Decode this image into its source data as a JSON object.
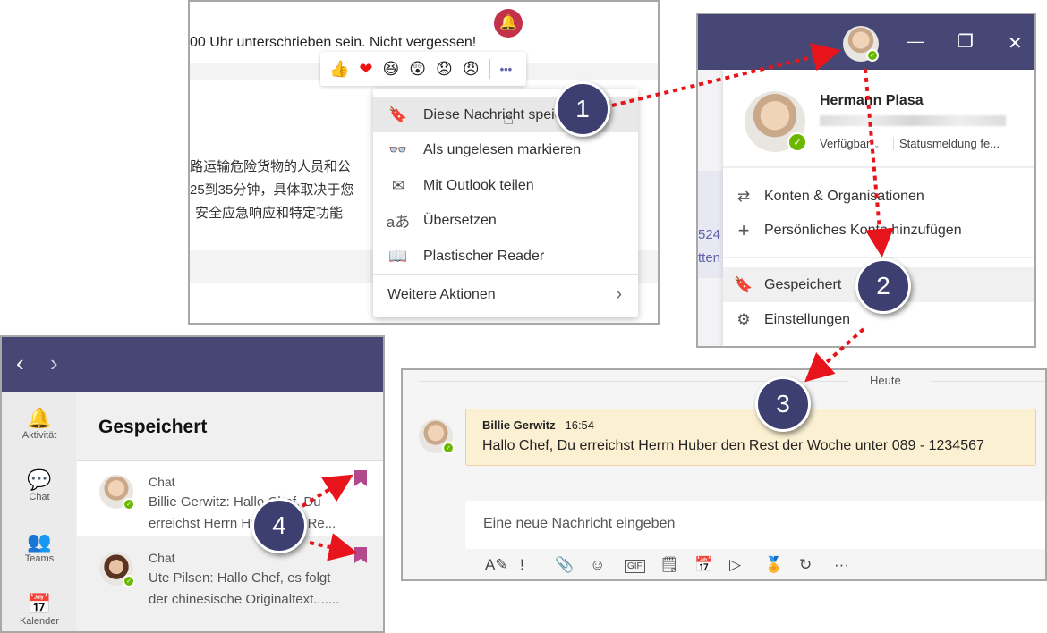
{
  "panel1": {
    "message_text": "00 Uhr unterschrieben sein. Nicht vergessen!",
    "chinese_lines": [
      "路运输危险货物的人员和公",
      "25到35分钟，具体取决于您",
      "安全应急响应和特定功能"
    ],
    "reactions": [
      "👍",
      "❤",
      "😆",
      "😲",
      "😟",
      "😠"
    ],
    "more_label": "•••",
    "menu": [
      {
        "icon": "bookmark-icon",
        "glyph": "🔖",
        "label": "Diese Nachricht speichern"
      },
      {
        "icon": "mark-unread-icon",
        "glyph": "👓",
        "label": "Als ungelesen markieren"
      },
      {
        "icon": "mail-icon",
        "glyph": "✉",
        "label": "Mit Outlook teilen"
      },
      {
        "icon": "translate-icon",
        "glyph": "aあ",
        "label": "Übersetzen"
      },
      {
        "icon": "immersive-reader-icon",
        "glyph": "📖",
        "label": "Plastischer Reader"
      }
    ],
    "more_actions": "Weitere Aktionen"
  },
  "panel2": {
    "window_controls": {
      "minimize": "—",
      "maximize": "❐",
      "close": "✕"
    },
    "profile_name": "Hermann Plasa",
    "presence": "Verfügbar",
    "status_message": "Statusmeldung fe...",
    "partial_left": [
      "524",
      "tten"
    ],
    "menu": [
      {
        "icon": "switch-icon",
        "glyph": "⇄",
        "label": "Konten & Organisationen"
      },
      {
        "icon": "plus-icon",
        "glyph": "+",
        "label": "Persönliches Konto hinzufügen"
      },
      {
        "icon": "bookmark-icon",
        "glyph": "🔖",
        "label": "Gespeichert"
      },
      {
        "icon": "gear-icon",
        "glyph": "⚙",
        "label": "Einstellungen"
      }
    ]
  },
  "panel3": {
    "nav": {
      "back": "‹",
      "forward": "›"
    },
    "rail": [
      {
        "icon": "bell-icon",
        "glyph": "🔔",
        "label": "Aktivität"
      },
      {
        "icon": "chat-icon",
        "glyph": "💬",
        "label": "Chat"
      },
      {
        "icon": "teams-icon",
        "glyph": "👥",
        "label": "Teams"
      },
      {
        "icon": "calendar-icon",
        "glyph": "📅",
        "label": "Kalender"
      }
    ],
    "title": "Gespeichert",
    "items": [
      {
        "type": "Chat",
        "line1": "Billie Gerwitz: Hallo Chef, Du",
        "line2": "erreichst Herrn Huber den Re..."
      },
      {
        "type": "Chat",
        "line1": "Ute Pilsen: Hallo Chef, es folgt",
        "line2": "der chinesische Originaltext......."
      }
    ]
  },
  "panel4": {
    "date_divider": "Heute",
    "message": {
      "author": "Billie Gerwitz",
      "time": "16:54",
      "text": "Hallo Chef, Du erreichst Herrn Huber den Rest der Woche unter 089 - 1234567"
    },
    "compose_placeholder": "Eine neue Nachricht eingeben",
    "toolbar": [
      {
        "icon": "format-icon",
        "glyph": "A✎"
      },
      {
        "icon": "important-icon",
        "glyph": "!"
      },
      {
        "icon": "attach-icon",
        "glyph": "📎"
      },
      {
        "icon": "emoji-icon",
        "glyph": "☺"
      },
      {
        "icon": "gif-icon",
        "glyph": "GIF"
      },
      {
        "icon": "sticker-icon",
        "glyph": "🗒"
      },
      {
        "icon": "meeting-icon",
        "glyph": "📅"
      },
      {
        "icon": "stream-icon",
        "glyph": "▷"
      },
      {
        "icon": "praise-icon",
        "glyph": "🏅"
      },
      {
        "icon": "loop-icon",
        "glyph": "↻"
      },
      {
        "icon": "more-icon",
        "glyph": "···"
      }
    ]
  },
  "badges": [
    "1",
    "2",
    "3",
    "4"
  ],
  "colors": {
    "teams_purple": "#464775",
    "badge": "#3d3f70",
    "arrow": "#e8141b",
    "saved_highlight": "#fbf0d2",
    "bookmark": "#b2498c",
    "available": "#6bb700"
  }
}
